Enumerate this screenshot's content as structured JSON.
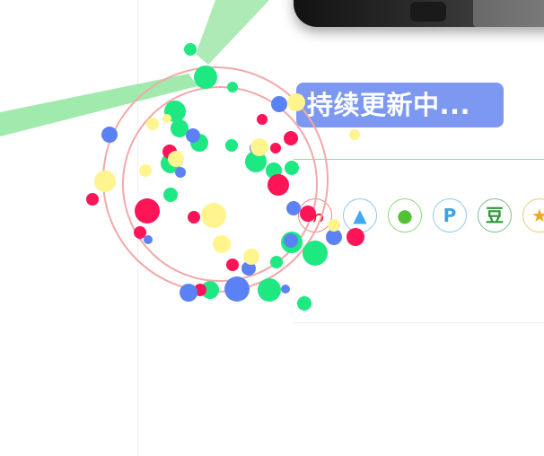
{
  "banner": {
    "text": "持续更新中..."
  },
  "photo": {
    "description_visible": ""
  },
  "share": {
    "buttons": [
      {
        "name": "weibo",
        "glyph": "❀",
        "color": "#e6162d"
      },
      {
        "name": "qq",
        "glyph": "▲",
        "color": "#3fa9f5"
      },
      {
        "name": "wechat",
        "glyph": "●",
        "color": "#51c332"
      },
      {
        "name": "pinterest",
        "glyph": "P",
        "color": "#3aa5de"
      },
      {
        "name": "douban",
        "glyph": "豆",
        "color": "#2e963d"
      },
      {
        "name": "favorite",
        "glyph": "★",
        "color": "#f5a623"
      }
    ]
  },
  "colors": {
    "accent_blue": "#7c98f0",
    "ring_red": "#f3a8a8",
    "dot_green": "#1ee882",
    "dot_pink": "#ff1457",
    "dot_blue": "#5b82f5",
    "dot_yellow": "#fff48d",
    "ribbon_green": "#8fe6a0"
  }
}
